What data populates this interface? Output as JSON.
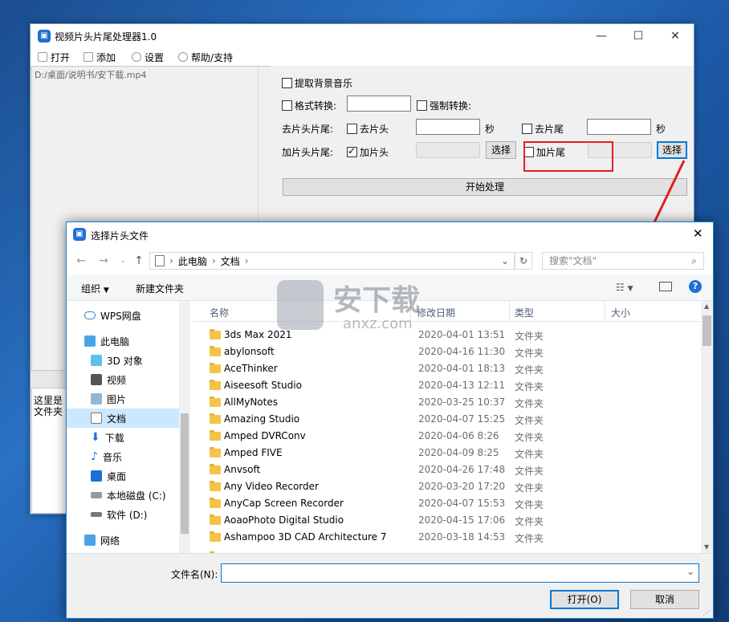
{
  "app": {
    "title": "视频片头片尾处理器1.0",
    "menu": [
      "打开",
      "添加",
      "设置",
      "帮助/支持"
    ],
    "file_path": "D:/桌面/说明书/安下载.mp4",
    "log_text": "这里是\n文件夹",
    "extract_music": "提取背景音乐",
    "format_convert": "格式转换:",
    "force_convert": "强制转换:",
    "remove_label": "去片头片尾:",
    "remove_head": "去片头",
    "remove_tail": "去片尾",
    "sec1": "秒",
    "sec2": "秒",
    "add_label": "加片头片尾:",
    "add_head": "加片头",
    "add_tail": "加片尾",
    "choose1": "选择",
    "choose2": "选择",
    "start": "开始处理"
  },
  "dialog": {
    "title": "选择片头文件",
    "breadcrumb": [
      "此电脑",
      "文档"
    ],
    "search_placeholder": "搜索\"文档\"",
    "organize": "组织",
    "new_folder": "新建文件夹",
    "nav": [
      "WPS网盘",
      "此电脑",
      "3D 对象",
      "视频",
      "图片",
      "文档",
      "下载",
      "音乐",
      "桌面",
      "本地磁盘 (C:)",
      "软件 (D:)",
      "网络"
    ],
    "columns": [
      "名称",
      "修改日期",
      "类型",
      "大小"
    ],
    "rows": [
      {
        "name": "3ds Max 2021",
        "date": "2020-04-01 13:51",
        "type": "文件夹"
      },
      {
        "name": "abylonsoft",
        "date": "2020-04-16 11:30",
        "type": "文件夹"
      },
      {
        "name": "AceThinker",
        "date": "2020-04-01 18:13",
        "type": "文件夹"
      },
      {
        "name": "Aiseesoft Studio",
        "date": "2020-04-13 12:11",
        "type": "文件夹"
      },
      {
        "name": "AllMyNotes",
        "date": "2020-03-25 10:37",
        "type": "文件夹"
      },
      {
        "name": "Amazing Studio",
        "date": "2020-04-07 15:25",
        "type": "文件夹"
      },
      {
        "name": "Amped DVRConv",
        "date": "2020-04-06 8:26",
        "type": "文件夹"
      },
      {
        "name": "Amped FIVE",
        "date": "2020-04-09 8:25",
        "type": "文件夹"
      },
      {
        "name": "Anvsoft",
        "date": "2020-04-26 17:48",
        "type": "文件夹"
      },
      {
        "name": "Any Video Recorder",
        "date": "2020-03-20 17:20",
        "type": "文件夹"
      },
      {
        "name": "AnyCap Screen Recorder",
        "date": "2020-04-07 15:53",
        "type": "文件夹"
      },
      {
        "name": "AoaoPhoto Digital Studio",
        "date": "2020-04-15 17:06",
        "type": "文件夹"
      },
      {
        "name": "Ashampoo 3D CAD Architecture 7",
        "date": "2020-03-18 14:53",
        "type": "文件夹"
      }
    ],
    "filename_label": "文件名(N):",
    "filename_value": "",
    "open": "打开(O)",
    "cancel": "取消"
  },
  "watermark": {
    "cn": "安下载",
    "en": "anxz.com"
  },
  "colors": {
    "accent": "#0078d7",
    "highlight": "#e02020",
    "desktop": "#1d5aa8"
  }
}
